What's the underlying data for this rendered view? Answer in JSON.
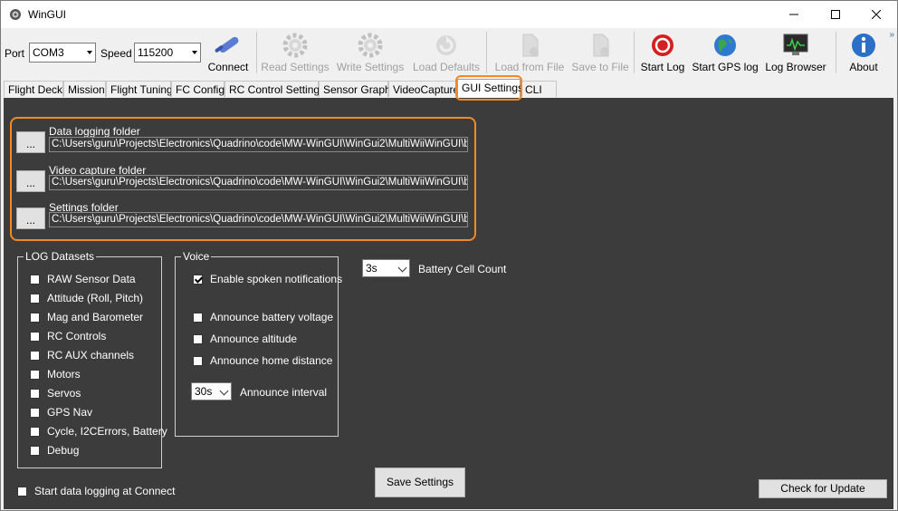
{
  "window": {
    "title": "WinGUI"
  },
  "toolbar": {
    "port_label": "Port",
    "port_value": "COM3",
    "speed_label": "Speed",
    "speed_value": "115200",
    "connect": "Connect",
    "read_settings": "Read Settings",
    "write_settings": "Write Settings",
    "load_defaults": "Load Defaults",
    "load_from_file": "Load from File",
    "save_to_file": "Save to File",
    "start_log": "Start Log",
    "start_gps_log": "Start GPS log",
    "log_browser": "Log Browser",
    "about": "About",
    "overflow": "»"
  },
  "tabs": [
    {
      "label": "Flight Deck"
    },
    {
      "label": "Mission"
    },
    {
      "label": "Flight Tuning"
    },
    {
      "label": "FC Config"
    },
    {
      "label": "RC Control Settings"
    },
    {
      "label": "Sensor Graph"
    },
    {
      "label": "VideoCapture"
    },
    {
      "label": "GUI Settings"
    },
    {
      "label": "CLI"
    }
  ],
  "folders": {
    "browse_label": "...",
    "data_logging": {
      "label": "Data logging folder",
      "path": "C:\\Users\\guru\\Projects\\Electronics\\Quadrino\\code\\MW-WinGUI\\WinGui2\\MultiWiiWinGUI\\bi"
    },
    "video_capture": {
      "label": "Video capture folder",
      "path": "C:\\Users\\guru\\Projects\\Electronics\\Quadrino\\code\\MW-WinGUI\\WinGui2\\MultiWiiWinGUI\\bi"
    },
    "settings": {
      "label": "Settings folder",
      "path": "C:\\Users\\guru\\Projects\\Electronics\\Quadrino\\code\\MW-WinGUI\\WinGui2\\MultiWiiWinGUI\\bi"
    }
  },
  "log_datasets": {
    "title": "LOG Datasets",
    "items": [
      {
        "label": "RAW Sensor Data"
      },
      {
        "label": "Attitude (Roll, Pitch)"
      },
      {
        "label": "Mag and Barometer"
      },
      {
        "label": "RC Controls"
      },
      {
        "label": "RC AUX channels"
      },
      {
        "label": "Motors"
      },
      {
        "label": "Servos"
      },
      {
        "label": "GPS Nav"
      },
      {
        "label": "Cycle, I2CErrors, Battery"
      },
      {
        "label": "Debug"
      }
    ]
  },
  "voice": {
    "title": "Voice",
    "enable_spoken": "Enable spoken notifications",
    "announce_battery": "Announce battery voltage",
    "announce_altitude": "Announce altitude",
    "announce_home": "Announce home distance",
    "interval_value": "30s",
    "interval_label": "Announce interval"
  },
  "battery": {
    "value": "3s",
    "label": "Battery Cell Count"
  },
  "start_logging_label": "Start data logging at Connect",
  "save_settings": "Save Settings",
  "check_update": "Check for Update"
}
